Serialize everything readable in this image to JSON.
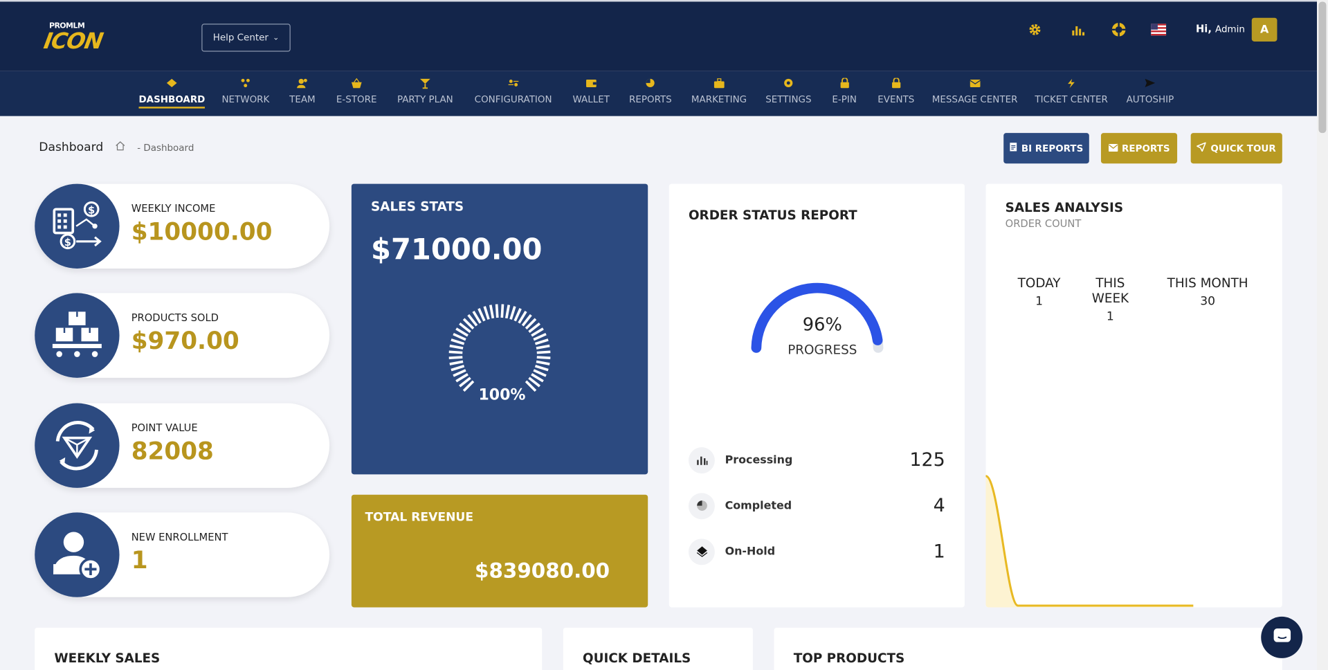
{
  "header": {
    "logo_small": "PROMLM",
    "logo_main": "ICON",
    "help_center": "Help Center",
    "greeting": "Hi,",
    "user": "Admin",
    "avatar_initial": "A"
  },
  "nav": [
    {
      "label": "DASHBOARD",
      "icon": "home-icon"
    },
    {
      "label": "NETWORK",
      "icon": "network-icon"
    },
    {
      "label": "TEAM",
      "icon": "team-icon"
    },
    {
      "label": "E-STORE",
      "icon": "basket-icon"
    },
    {
      "label": "PARTY PLAN",
      "icon": "cocktail-icon"
    },
    {
      "label": "CONFIGURATION",
      "icon": "configuration-icon"
    },
    {
      "label": "WALLET",
      "icon": "wallet-icon"
    },
    {
      "label": "REPORTS",
      "icon": "pie-chart-icon"
    },
    {
      "label": "MARKETING",
      "icon": "briefcase-icon"
    },
    {
      "label": "SETTINGS",
      "icon": "gear-icon"
    },
    {
      "label": "E-PIN",
      "icon": "lock-icon"
    },
    {
      "label": "EVENTS",
      "icon": "lock-icon"
    },
    {
      "label": "MESSAGE CENTER",
      "icon": "mail-icon"
    },
    {
      "label": "TICKET CENTER",
      "icon": "bolt-icon"
    },
    {
      "label": "AUTOSHIP",
      "icon": "send-icon"
    }
  ],
  "breadcrumb": {
    "title": "Dashboard",
    "current": "- Dashboard"
  },
  "actions": {
    "bi_reports": "BI REPORTS",
    "reports": "REPORTS",
    "quick_tour": "QUICK TOUR"
  },
  "stats": [
    {
      "label": "WEEKLY INCOME",
      "value": "$10000.00",
      "icon": "income-calculator-icon"
    },
    {
      "label": "PRODUCTS SOLD",
      "value": "$970.00",
      "icon": "boxes-icon"
    },
    {
      "label": "POINT VALUE",
      "value": "82008",
      "icon": "diamond-icon"
    },
    {
      "label": "NEW ENROLLMENT",
      "value": "1",
      "icon": "add-user-icon"
    }
  ],
  "sales_stats": {
    "title": "SALES STATS",
    "value": "$71000.00",
    "percent": "100%",
    "fraction": 1.0
  },
  "total_revenue": {
    "title": "TOTAL REVENUE",
    "value": "$839080.00"
  },
  "order_status": {
    "title": "ORDER STATUS REPORT",
    "percent": "96%",
    "progress_label": "PROGRESS",
    "fraction": 0.96,
    "rows": [
      {
        "name": "Processing",
        "value": "125",
        "icon": "bar-chart-icon"
      },
      {
        "name": "Completed",
        "value": "4",
        "icon": "pie-chart-icon"
      },
      {
        "name": "On-Hold",
        "value": "1",
        "icon": "layers-icon"
      }
    ]
  },
  "sales_analysis": {
    "title": "SALES ANALYSIS",
    "subtitle": "ORDER COUNT",
    "periods": [
      {
        "label": "TODAY",
        "value": "1"
      },
      {
        "label": "THIS WEEK",
        "value": "1"
      },
      {
        "label": "THIS MONTH",
        "value": "30"
      }
    ]
  },
  "chart_data": {
    "type": "area",
    "series": [
      {
        "values": [
          30,
          0,
          0,
          0,
          0,
          0,
          0,
          0
        ]
      }
    ],
    "colors": {
      "line": "#e8b923",
      "fill": "#fdf3d2"
    }
  },
  "bottom": {
    "weekly_sales": "WEEKLY SALES",
    "quick_details": "QUICK DETAILS",
    "top_products": "TOP PRODUCTS"
  },
  "colors": {
    "navy": "#13254a",
    "nav": "#172c54",
    "blue_card": "#2c4a80",
    "gold": "#b89a23",
    "gold_text": "#b8951e",
    "accent": "#e6b71d"
  }
}
